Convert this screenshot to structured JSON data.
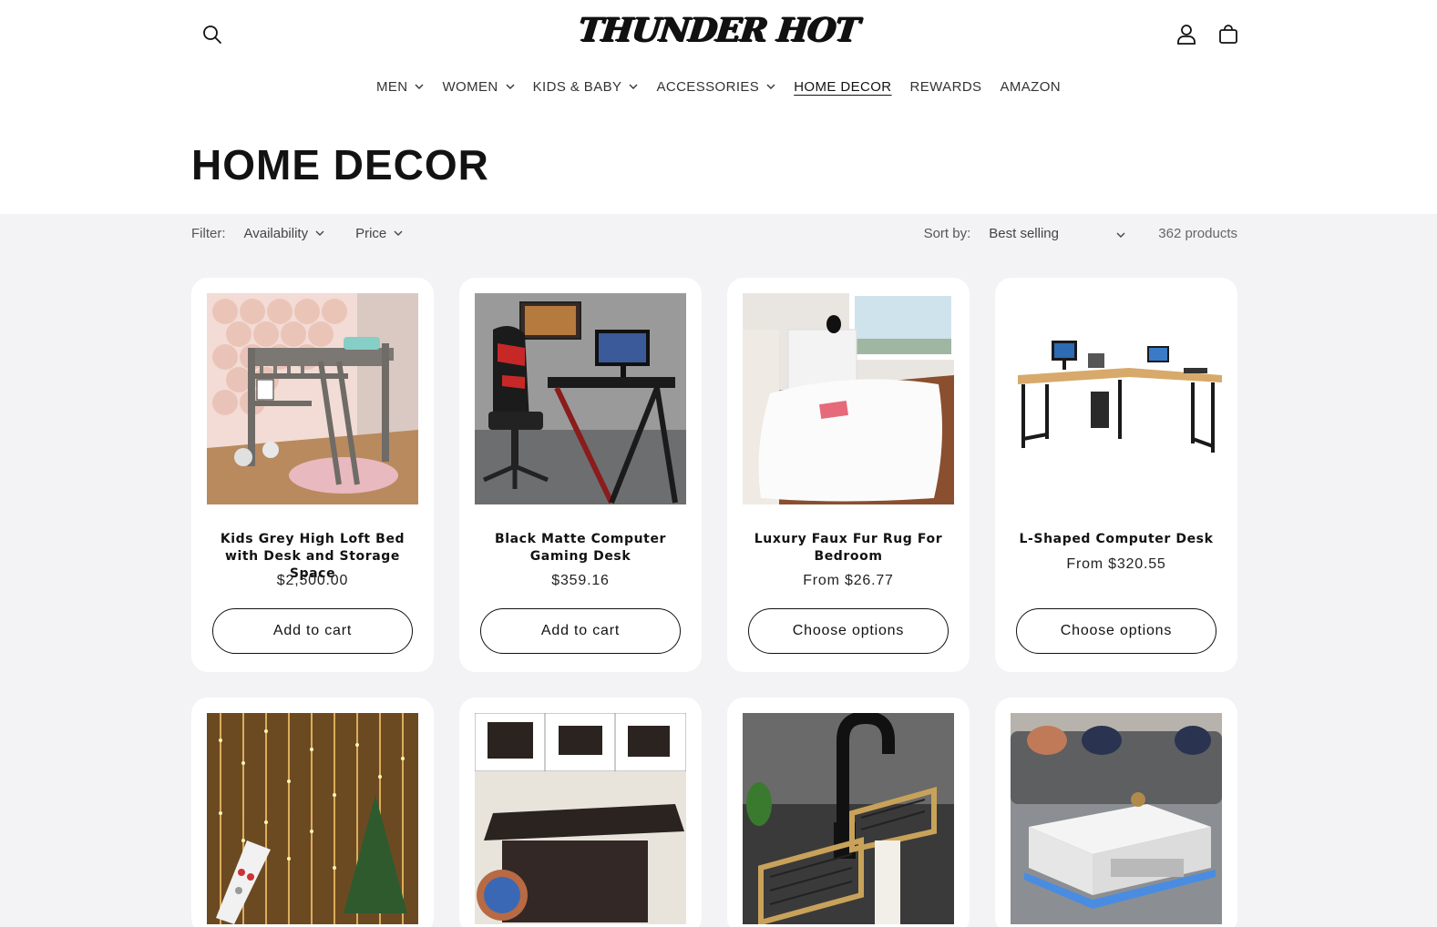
{
  "header": {
    "logo_text": "THUNDER HOT",
    "search_icon": "search-icon",
    "account_icon": "user-icon",
    "cart_icon": "cart-icon"
  },
  "nav": {
    "items": [
      {
        "label": "MEN",
        "dropdown": true
      },
      {
        "label": "WOMEN",
        "dropdown": true
      },
      {
        "label": "KIDS & BABY",
        "dropdown": true
      },
      {
        "label": "ACCESSORIES",
        "dropdown": true
      },
      {
        "label": "HOME DECOR",
        "dropdown": false,
        "active": true
      },
      {
        "label": "REWARDS",
        "dropdown": false
      },
      {
        "label": "AMAZON",
        "dropdown": false
      }
    ]
  },
  "page": {
    "title": "HOME DECOR"
  },
  "filters": {
    "label": "Filter:",
    "availability": "Availability",
    "price": "Price",
    "sort_label": "Sort by:",
    "sort_value": "Best selling",
    "count": "362 products"
  },
  "products": [
    {
      "title": "Kids Grey High Loft Bed with Desk and Storage Space",
      "price": "$2,500.00",
      "button": "Add to cart"
    },
    {
      "title": "Black Matte Computer Gaming Desk",
      "price": "$359.16",
      "button": "Add to cart"
    },
    {
      "title": "Luxury Faux Fur Rug For Bedroom",
      "price": "From $26.77",
      "button": "Choose options"
    },
    {
      "title": "L-Shaped Computer Desk",
      "price": "From $320.55",
      "button": "Choose options"
    }
  ],
  "colors": {
    "text": "#121212",
    "listing_bg": "#f3f3f5",
    "card_bg": "#ffffff"
  }
}
